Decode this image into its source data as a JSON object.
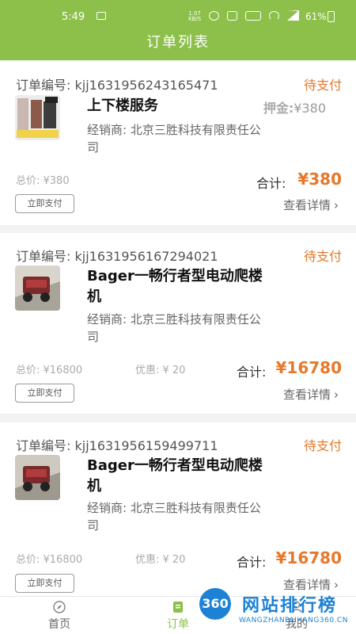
{
  "status_bar": {
    "time": "5:49",
    "net_speed_value": "1.07",
    "net_speed_unit": "KB/S",
    "battery": "61%",
    "icons": [
      "image-icon",
      "alarm-icon",
      "nfc-icon",
      "hd-icon",
      "wifi-icon",
      "signal-icon",
      "battery-icon"
    ]
  },
  "header": {
    "title": "订单列表"
  },
  "orders": [
    {
      "order_no": "订单编号: kjj1631956243165471",
      "status": "待支付",
      "name": "上下楼服务",
      "deposit_label": "押金:",
      "deposit_value": "¥380",
      "dealer": "经销商: 北京三胜科技有限责任公司",
      "total_price": "总价: ¥380",
      "discount": "",
      "sum_label": "合计:",
      "sum_value": "¥380",
      "pay_button": "立即支付",
      "detail_link": "查看详情"
    },
    {
      "order_no": "订单编号: kjj1631956167294021",
      "status": "待支付",
      "name": "Bager一畅行者型电动爬楼机",
      "dealer": "经销商: 北京三胜科技有限责任公司",
      "total_price": "总价: ¥16800",
      "discount": "优惠: ¥ 20",
      "sum_label": "合计:",
      "sum_value": "¥16780",
      "pay_button": "立即支付",
      "detail_link": "查看详情"
    },
    {
      "order_no": "订单编号: kjj1631956159499711",
      "status": "待支付",
      "name": "Bager一畅行者型电动爬楼机",
      "dealer": "经销商: 北京三胜科技有限责任公司",
      "total_price": "总价: ¥16800",
      "discount": "优惠: ¥ 20",
      "sum_label": "合计:",
      "sum_value": "¥16780",
      "pay_button": "立即支付",
      "detail_link": "查看详情"
    }
  ],
  "tabs": [
    {
      "label": "首页",
      "icon": "compass-icon",
      "active": false
    },
    {
      "label": "订单",
      "icon": "order-icon",
      "active": true
    },
    {
      "label": "我的",
      "icon": "user-icon",
      "active": false
    }
  ],
  "watermark": {
    "logo_text": "360",
    "title": "网站排行榜",
    "sub": "WANGZHANPAIHANG360.CN"
  },
  "colors": {
    "primary": "#8cc04a",
    "accent": "#e6782a",
    "watermark": "#1d82d6"
  }
}
